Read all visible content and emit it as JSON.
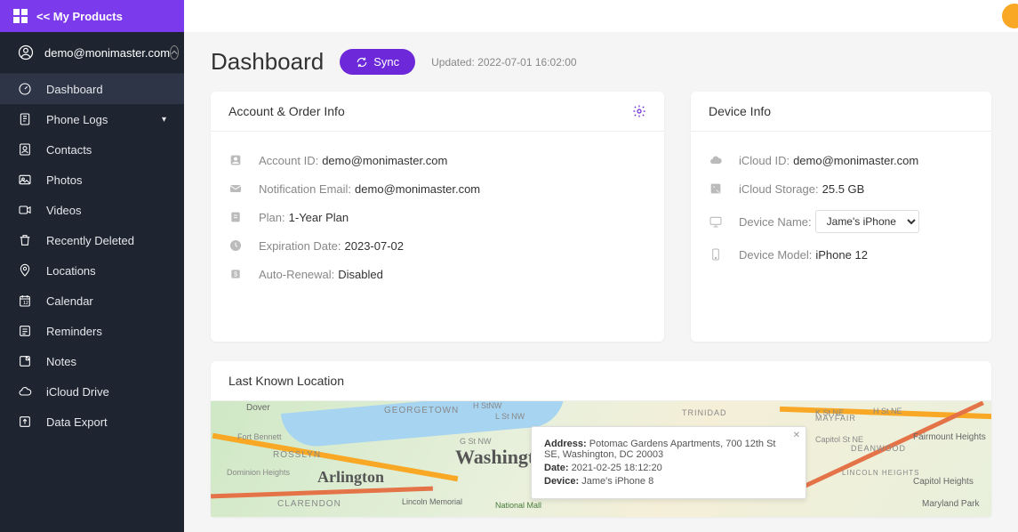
{
  "header": {
    "back_label": "<< My Products"
  },
  "user": {
    "email": "demo@monimaster.com"
  },
  "nav": {
    "dashboard": "Dashboard",
    "phone_logs": "Phone Logs",
    "contacts": "Contacts",
    "photos": "Photos",
    "videos": "Videos",
    "recently_deleted": "Recently Deleted",
    "locations": "Locations",
    "calendar": "Calendar",
    "reminders": "Reminders",
    "notes": "Notes",
    "icloud_drive": "iCloud Drive",
    "data_export": "Data Export"
  },
  "page": {
    "title": "Dashboard",
    "sync": "Sync",
    "updated": "Updated: 2022-07-01 16:02:00"
  },
  "account": {
    "card_title": "Account & Order Info",
    "id_label": "Account ID:",
    "id_value": "demo@monimaster.com",
    "email_label": "Notification Email:",
    "email_value": "demo@monimaster.com",
    "plan_label": "Plan:",
    "plan_value": "1-Year Plan",
    "exp_label": "Expiration Date:",
    "exp_value": "2023-07-02",
    "renew_label": "Auto-Renewal:",
    "renew_value": "Disabled"
  },
  "device": {
    "card_title": "Device Info",
    "icloud_label": "iCloud ID:",
    "icloud_value": "demo@monimaster.com",
    "storage_label": "iCloud Storage:",
    "storage_value": "25.5 GB",
    "name_label": "Device Name:",
    "name_value": "Jame's iPhone",
    "model_label": "Device Model:",
    "model_value": "iPhone 12"
  },
  "location": {
    "card_title": "Last Known Location",
    "map": {
      "city1": "Arlington",
      "city2": "Washington",
      "area1": "Dover",
      "area2": "GEORGETOWN",
      "area3": "ROSSLYN",
      "area4": "CLARENDON",
      "area5": "Dominion Heights",
      "area6": "Fort Bennett",
      "area7": "Lincoln Memorial",
      "area8": "National Mall",
      "area9": "L St NW",
      "area10": "G St NW",
      "area11": "H StNW",
      "area12": "K St NE",
      "area13": "Capitol St NE",
      "area14": "H St NE",
      "area15": "TRINIDAD",
      "area16": "Capitol Heights",
      "area17": "Fairmount Heights",
      "area18": "Maryland Park",
      "area19": "MAYFAIR",
      "area20": "DEANWOOD",
      "area21": "LINCOLN HEIGHTS"
    },
    "popup": {
      "addr_label": "Address:",
      "addr_value": "Potomac Gardens Apartments, 700 12th St SE, Washington, DC 20003",
      "date_label": "Date:",
      "date_value": "2021-02-25 18:12:20",
      "device_label": "Device:",
      "device_value": "Jame's iPhone 8"
    }
  }
}
